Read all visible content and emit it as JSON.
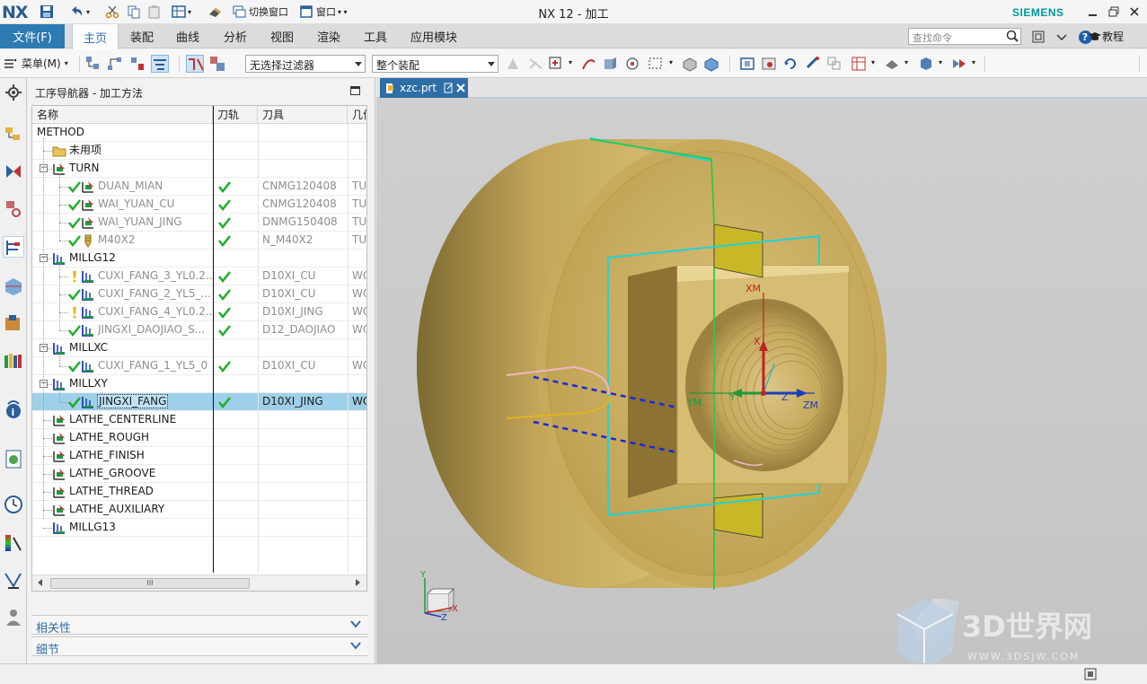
{
  "window": {
    "logo": "NX",
    "title": "NX 12 - 加工",
    "brand": "SIEMENS",
    "quick_access": {
      "switch_window": "切换窗口",
      "window": "窗口"
    }
  },
  "ribbon": {
    "file_tab": "文件(F)",
    "tabs": [
      "主页",
      "装配",
      "曲线",
      "分析",
      "视图",
      "渲染",
      "工具",
      "应用模块"
    ],
    "active_tab": "主页",
    "search_placeholder": "查找命令",
    "tutorial": "教程"
  },
  "toolbar": {
    "menu_label": "菜单(M)",
    "selection_filter": "无选择过滤器",
    "scope": "整个装配"
  },
  "navigator": {
    "title": "工序导航器 - 加工方法",
    "columns": [
      "名称",
      "刀轨",
      "刀具",
      "几何"
    ],
    "rows": [
      {
        "name": "METHOD",
        "tool": "",
        "geom": "",
        "path_ok": false
      },
      {
        "name": "未用项",
        "tool": "",
        "geom": "",
        "path_ok": false
      },
      {
        "name": "TURN",
        "tool": "",
        "geom": "",
        "path_ok": false
      },
      {
        "name": "DUAN_MIAN",
        "tool": "CNMG120408",
        "geom": "TU",
        "path_ok": true
      },
      {
        "name": "WAI_YUAN_CU",
        "tool": "CNMG120408",
        "geom": "TU",
        "path_ok": true
      },
      {
        "name": "WAI_YUAN_JING",
        "tool": "DNMG150408",
        "geom": "TU",
        "path_ok": true
      },
      {
        "name": "M40X2",
        "tool": "N_M40X2",
        "geom": "TU",
        "path_ok": true
      },
      {
        "name": "MILLG12",
        "tool": "",
        "geom": "",
        "path_ok": false
      },
      {
        "name": "CUXI_FANG_3_YL0.2...",
        "tool": "D10XI_CU",
        "geom": "WO",
        "path_ok": true
      },
      {
        "name": "CUXI_FANG_2_YL5_...",
        "tool": "D10XI_CU",
        "geom": "WO",
        "path_ok": true
      },
      {
        "name": "CUXI_FANG_4_YL0.2...",
        "tool": "D10XI_JING",
        "geom": "WO",
        "path_ok": true
      },
      {
        "name": "JINGXI_DAOJIAO_S...",
        "tool": "D12_DAOJIAO",
        "geom": "WO",
        "path_ok": true
      },
      {
        "name": "MILLXC",
        "tool": "",
        "geom": "",
        "path_ok": false
      },
      {
        "name": "CUXI_FANG_1_YL5_0",
        "tool": "D10XI_CU",
        "geom": "WO",
        "path_ok": true
      },
      {
        "name": "MILLXY",
        "tool": "",
        "geom": "",
        "path_ok": false
      },
      {
        "name": "JINGXI_FANG",
        "tool": "D10XI_JING",
        "geom": "WO",
        "path_ok": true
      },
      {
        "name": "LATHE_CENTERLINE",
        "tool": "",
        "geom": "",
        "path_ok": false
      },
      {
        "name": "LATHE_ROUGH",
        "tool": "",
        "geom": "",
        "path_ok": false
      },
      {
        "name": "LATHE_FINISH",
        "tool": "",
        "geom": "",
        "path_ok": false
      },
      {
        "name": "LATHE_GROOVE",
        "tool": "",
        "geom": "",
        "path_ok": false
      },
      {
        "name": "LATHE_THREAD",
        "tool": "",
        "geom": "",
        "path_ok": false
      },
      {
        "name": "LATHE_AUXILIARY",
        "tool": "",
        "geom": "",
        "path_ok": false
      },
      {
        "name": "MILLG13",
        "tool": "",
        "geom": "",
        "path_ok": false
      }
    ],
    "selected_row": "JINGXI_FANG",
    "scroll_glyph": "III",
    "sections": [
      "相关性",
      "细节"
    ]
  },
  "viewport": {
    "document_tab": "xzc.prt",
    "csys_labels": {
      "xm": "XM",
      "ym": "YM",
      "zm": "ZM",
      "x": "X",
      "y": "Y",
      "z": "Z"
    },
    "triad_labels": {
      "x": "X",
      "y": "Y",
      "z": "Z"
    },
    "watermark": {
      "brand": "3D世界网",
      "url": "WWW.3DSJW.COM"
    }
  },
  "colors": {
    "file_tab": "#2e7ab2",
    "part_gold": "#c9ad5c",
    "selection_row": "#9fd0ea",
    "check_green": "#1fae2c",
    "brand_teal": "#009999"
  }
}
